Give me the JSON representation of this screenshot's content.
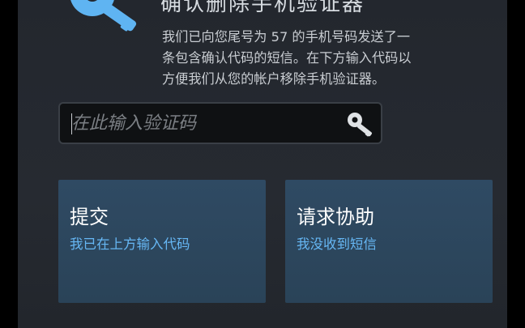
{
  "header": {
    "title": "确认删除手机验证器",
    "description": "我们已向您尾号为 57 的手机号码发送了一\n条包含确认代码的短信。在下方输入代码以\n方便我们从您的帐户移除手机验证器。"
  },
  "code_input": {
    "placeholder": "在此输入验证码",
    "value": ""
  },
  "actions": {
    "submit": {
      "title": "提交",
      "subtitle": "我已在上方输入代码"
    },
    "help": {
      "title": "请求协助",
      "subtitle": "我没收到短信"
    }
  },
  "colors": {
    "background": "#24282f",
    "button": "#2d475e",
    "link": "#66b7f4"
  },
  "icons": {
    "header": "key-icon",
    "input": "key-icon"
  }
}
